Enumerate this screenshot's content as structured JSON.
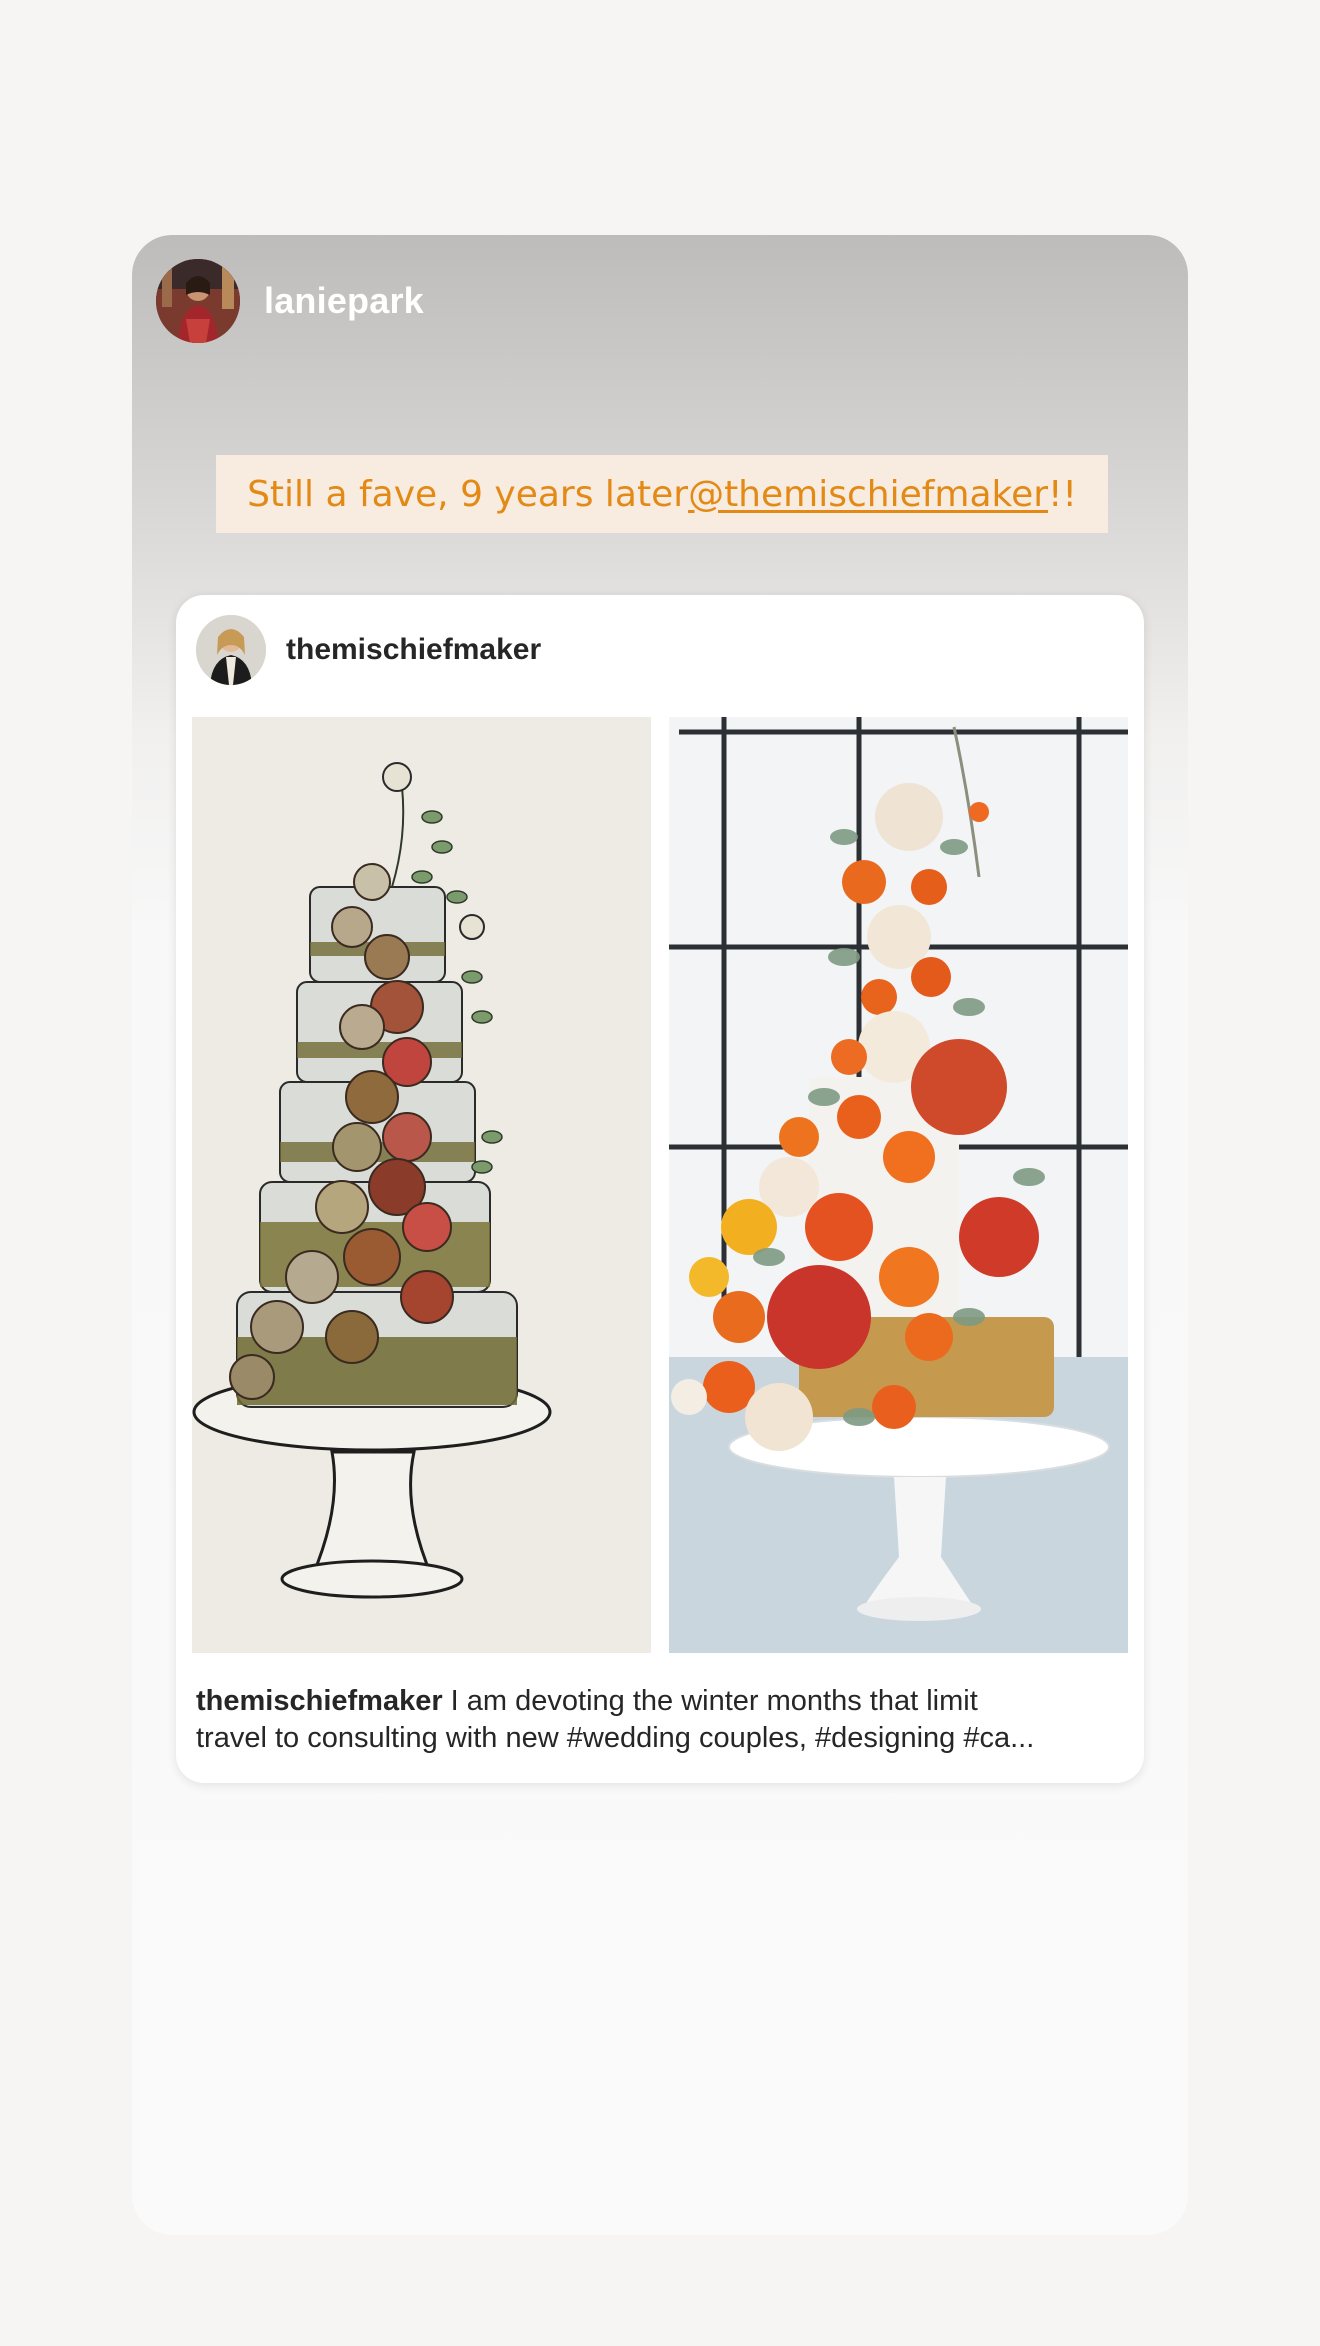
{
  "story": {
    "username": "laniepark",
    "caption_prefix": "Still a fave, 9 years later ",
    "caption_mention": "@themischiefmaker",
    "caption_suffix": " !!"
  },
  "post": {
    "username": "themischiefmaker",
    "caption_username": "themischiefmaker",
    "caption_line1_text": " I am devoting the winter months that limit",
    "caption_line2_text": "travel to consulting with new #wedding couples, #designing #ca..."
  },
  "icons": {
    "story_avatar": "user-avatar-photo",
    "post_avatar": "user-avatar-photo"
  },
  "colors": {
    "caption_text": "#e38a16",
    "caption_bg": "#f8ece0",
    "username_story": "#ffffff",
    "username_post": "#262626"
  }
}
